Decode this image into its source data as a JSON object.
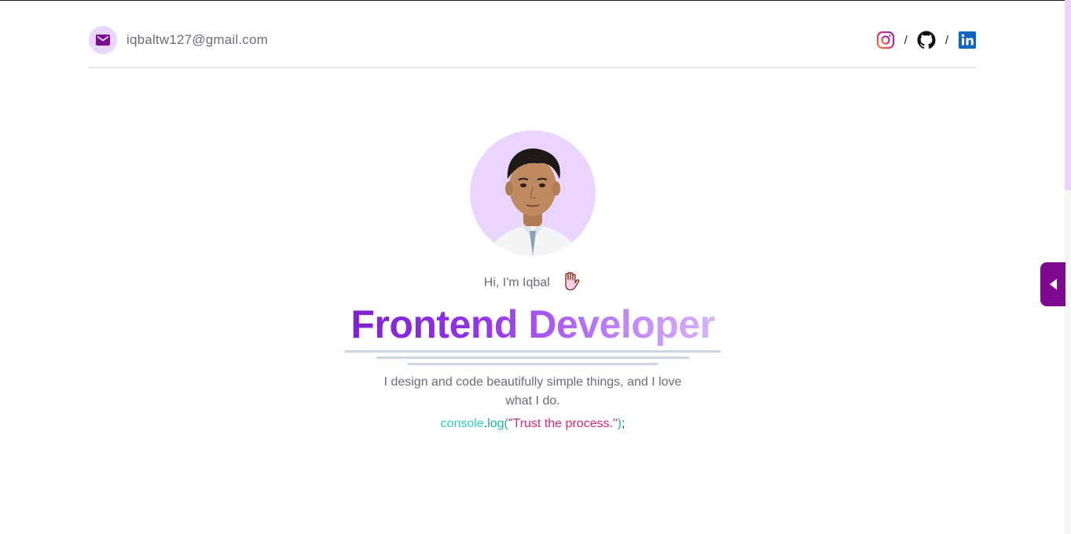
{
  "header": {
    "email": "iqbaltw127@gmail.com",
    "icons": {
      "mail": "mail-icon",
      "instagram": "instagram-icon",
      "github": "github-icon",
      "linkedin": "linkedin-icon"
    },
    "separator": "/"
  },
  "hero": {
    "greeting": "Hi, I'm Iqbal",
    "wave_icon": "waving-hand-icon",
    "title": "Frontend Developer",
    "tagline": "I design and code beautifully simple things, and I love what I do.",
    "code": {
      "object": "console",
      "dot": ".",
      "method": "log",
      "open_paren": "(",
      "string": "\"Trust the process.\"",
      "close_paren": ")",
      "semicolon": ";"
    }
  },
  "side_toggle": {
    "icon": "caret-left-icon"
  },
  "colors": {
    "accent": "#7e0a8f",
    "avatar_bg": "#e9d5ff",
    "instagram": "#e1306c",
    "linkedin": "#0a66c2",
    "gradient_start": "#7e22ce",
    "gradient_end": "#d8b4fe"
  }
}
